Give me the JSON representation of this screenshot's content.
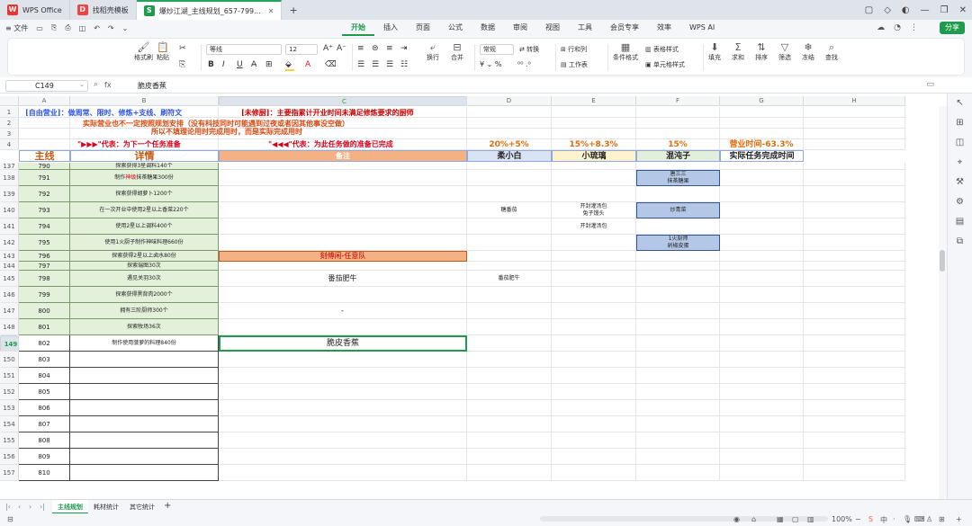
{
  "titlebar": {
    "tabs": [
      {
        "label": "WPS Office",
        "logo": "W"
      },
      {
        "label": "找稻壳模板",
        "logo": "D"
      },
      {
        "label": "爆炒江湖_主线规划_657-799...",
        "logo": "S"
      }
    ],
    "new_tab": "+"
  },
  "menubar": {
    "file": "≡ 文件",
    "menus": [
      "开始",
      "插入",
      "页面",
      "公式",
      "数据",
      "审阅",
      "视图",
      "工具",
      "会员专享",
      "效率",
      "WPS AI"
    ],
    "active_menu": "开始",
    "share": "分享"
  },
  "ribbon": {
    "format_painter": "格式刷",
    "paste": "粘贴",
    "font_name": "等线",
    "font_size": "12",
    "wrap": "换行",
    "merge": "合并",
    "number_format": "常规",
    "convert": "转换",
    "row_col": "行和列",
    "worksheet": "工作表",
    "cond_format": "条件格式",
    "table_style": "表格样式",
    "cell_style": "单元格样式",
    "fill": "填充",
    "sum": "求和",
    "sort": "排序",
    "filter": "筛选",
    "freeze": "冻结",
    "find": "查找",
    "font_color": "#e02020",
    "highlight_color": "#f5d33a"
  },
  "formula_bar": {
    "cell_ref": "C149",
    "fx": "fx",
    "value": "脆皮香蕉"
  },
  "columns": [
    "A",
    "B",
    "C",
    "D",
    "E",
    "F",
    "G",
    "H"
  ],
  "header_rows": {
    "r1_a": "[自由营业]：做周常、限时、修炼+支线、刷符文",
    "r1_c": "[未修厨]：主要指累计开业时间未满足修炼要求的厨师",
    "r2": "实际营业也不一定按照规划安排（没有科技同时可能遇到过夜或者因其他事没空做）",
    "r2b": "所以不填理论用时完成用时，而是实际完成用时",
    "r3_a": "\"▶▶▶\"代表：为下一个任务准备",
    "r3_c": "\"◀◀◀\"代表：为此任务做的准备已完成",
    "r3_d": "20%+5%",
    "r3_e": "15%+8.3%",
    "r3_f": "15%",
    "r3_g": "营业时间-63.3%",
    "r4_a": "主线",
    "r4_b": "详情",
    "r4_c": "备注",
    "r4_d": "柔小白",
    "r4_e": "小琉璃",
    "r4_f": "混沌子",
    "r4_g": "实际任务完成时间"
  },
  "rows": [
    {
      "row": "137",
      "a": "790",
      "b": "探索获得3星调料140个",
      "c": "",
      "d": "",
      "e": "",
      "f": ""
    },
    {
      "row": "138",
      "a": "791",
      "b": "制作神级抹茶糖果300份",
      "c": "",
      "d": "",
      "e": "",
      "f": "唐三三\n抹茶糖果"
    },
    {
      "row": "139",
      "a": "792",
      "b": "探索获得胡萝卜1200个",
      "c": "",
      "d": "",
      "e": "",
      "f": ""
    },
    {
      "row": "140",
      "a": "793",
      "b": "在一次开业中使用2星以上香菜220个",
      "c": "",
      "d": "糖番茄",
      "e": "开封灌汤包\n兔子馒头",
      "f": "炒青菜"
    },
    {
      "row": "141",
      "a": "794",
      "b": "使用2星以上调料400个",
      "c": "",
      "d": "",
      "e": "开封灌汤包",
      "f": ""
    },
    {
      "row": "142",
      "a": "795",
      "b": "使用1火厨子制作神味料理660份",
      "c": "",
      "d": "",
      "e": "",
      "f": "1火厨师\n剁椒皮蛋"
    },
    {
      "row": "143",
      "a": "796",
      "b": "探索获得2星以上卤水80份",
      "c": "刻傅闲-任意队",
      "d": "",
      "e": "",
      "f": ""
    },
    {
      "row": "144",
      "a": "797",
      "b": "探索瑞图30次",
      "c": "",
      "d": "",
      "e": "",
      "f": ""
    },
    {
      "row": "145",
      "a": "798",
      "b": "遇见关羽30次",
      "c": "番茄肥牛",
      "d": "番茄肥牛",
      "e": "",
      "f": ""
    },
    {
      "row": "146",
      "a": "799",
      "b": "探索获得黑背肉2000个",
      "c": "",
      "d": "",
      "e": "",
      "f": ""
    },
    {
      "row": "147",
      "a": "800",
      "b": "拥有三阶厨师300个",
      "c": "-",
      "d": "",
      "e": "",
      "f": ""
    },
    {
      "row": "148",
      "a": "801",
      "b": "探索牧场36次",
      "c": "",
      "d": "",
      "e": "",
      "f": ""
    },
    {
      "row": "149",
      "a": "802",
      "b": "制作使用菠萝的料理840份",
      "c": "脆皮香蕉",
      "d": "",
      "e": "",
      "f": ""
    },
    {
      "row": "150",
      "a": "803",
      "b": "",
      "c": "",
      "d": "",
      "e": "",
      "f": ""
    },
    {
      "row": "151",
      "a": "804",
      "b": "",
      "c": "",
      "d": "",
      "e": "",
      "f": ""
    },
    {
      "row": "152",
      "a": "805",
      "b": "",
      "c": "",
      "d": "",
      "e": "",
      "f": ""
    },
    {
      "row": "153",
      "a": "806",
      "b": "",
      "c": "",
      "d": "",
      "e": "",
      "f": ""
    },
    {
      "row": "154",
      "a": "807",
      "b": "",
      "c": "",
      "d": "",
      "e": "",
      "f": ""
    },
    {
      "row": "155",
      "a": "808",
      "b": "",
      "c": "",
      "d": "",
      "e": "",
      "f": ""
    },
    {
      "row": "156",
      "a": "809",
      "b": "",
      "c": "",
      "d": "",
      "e": "",
      "f": ""
    },
    {
      "row": "157",
      "a": "810",
      "b": "",
      "c": "",
      "d": "",
      "e": "",
      "f": ""
    }
  ],
  "sheets": [
    "主线规划",
    "耗材统计",
    "其它统计"
  ],
  "active_sheet": "主线规划",
  "status": {
    "zoom": "100%",
    "zoom_minus": "−",
    "zoom_plus": "+"
  },
  "colors": {
    "accent": "#1f9b4d",
    "header_orange": "#f4b183",
    "header_blue": "#dae3f3",
    "header_yellow": "#fff2cc",
    "header_green": "#e2efda",
    "note_orange": "#f4b183",
    "box_blue": "#b4c7e7",
    "title_red": "#d9480f",
    "title_blue": "#2f54eb"
  }
}
